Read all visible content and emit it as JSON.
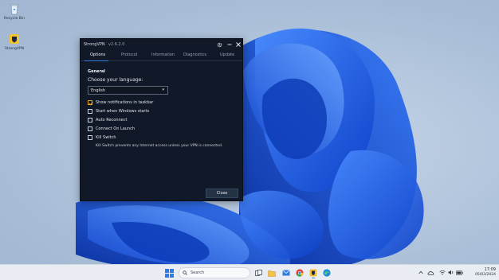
{
  "desktop": {
    "icons": [
      {
        "label": "Recycle Bin",
        "icon": "recycle-bin-icon"
      },
      {
        "label": "StrongVPN",
        "icon": "strongvpn-icon"
      }
    ]
  },
  "window": {
    "app_name": "StrongVPN",
    "version": "v2.6.2.0",
    "buttons": {
      "settings": "gear-icon",
      "minimize": "minimize-icon",
      "close": "close-icon"
    },
    "tabs": [
      {
        "label": "Options",
        "active": true
      },
      {
        "label": "Protocol",
        "active": false
      },
      {
        "label": "Information",
        "active": false
      },
      {
        "label": "Diagnostics",
        "active": false
      },
      {
        "label": "Update",
        "active": false
      }
    ],
    "section_title": "General",
    "language_label": "Choose your language:",
    "language_value": "English",
    "options": [
      {
        "label": "Show notifications in taskbar",
        "checked": true
      },
      {
        "label": "Start when Windows starts",
        "checked": false
      },
      {
        "label": "Auto Reconnect",
        "checked": false
      },
      {
        "label": "Connect On Launch",
        "checked": false
      },
      {
        "label": "Kill Switch",
        "checked": false
      }
    ],
    "kill_switch_description": "Kill Switch prevents any Internet access unless your VPN is connected.",
    "close_button_label": "Close"
  },
  "taskbar": {
    "search_placeholder": "Search",
    "clock": {
      "time": "17:09",
      "date": "05/03/2024"
    }
  },
  "colors": {
    "window_bg": "#111827",
    "accent": "#2f7de1",
    "checkbox_checked": "#e0a21a",
    "taskbar_bg": "#e9edf3"
  }
}
